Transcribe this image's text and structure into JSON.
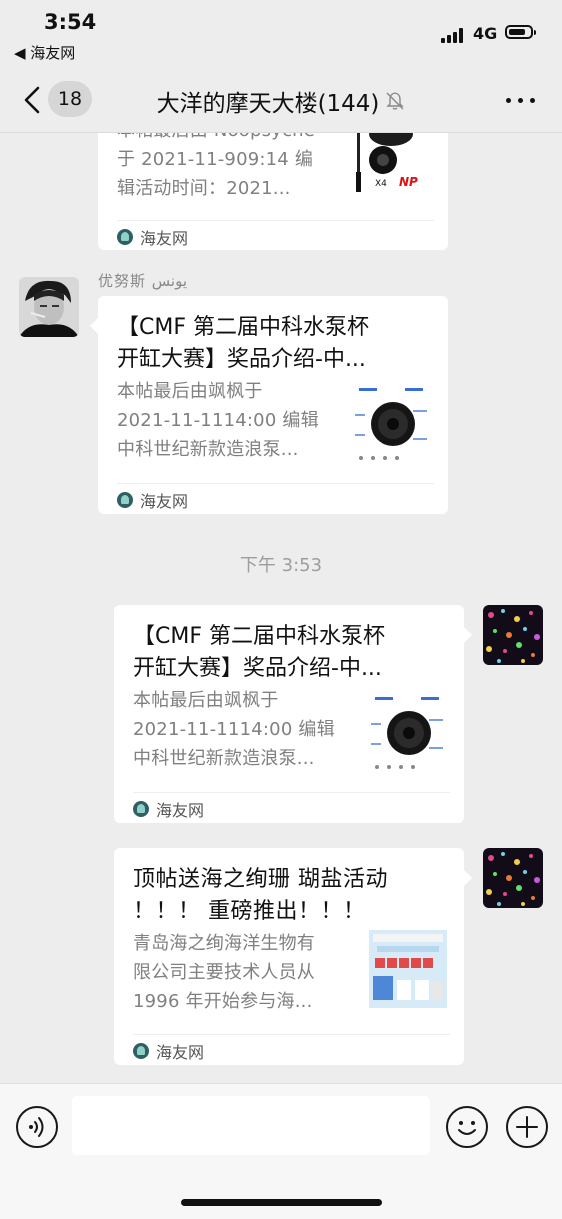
{
  "status": {
    "time": "3:54",
    "back_app": "◀ 海友网",
    "network": "4G",
    "battery_level": 0.8
  },
  "nav": {
    "unread_count": "18",
    "title": "大洋的摩天大楼(144)",
    "muted": true
  },
  "messages": [
    {
      "direction": "incoming",
      "desc_lines": [
        "本帖最后由 Noopsyche",
        "于 2021-11-909:14 编",
        "辑活动时间：2021..."
      ],
      "source": "海友网"
    },
    {
      "direction": "incoming",
      "sender": "优努斯 يونس",
      "title_lines": [
        "【CMF 第二届中科水泵杯",
        "开缸大赛】奖品介绍-中..."
      ],
      "desc_lines": [
        "本帖最后由飒枫于",
        "2021-11-1114:00 编辑",
        "中科世纪新款造浪泵..."
      ],
      "source": "海友网"
    },
    {
      "type": "timestamp",
      "text": "下午 3:53"
    },
    {
      "direction": "outgoing",
      "title_lines": [
        "【CMF 第二届中科水泵杯",
        "开缸大赛】奖品介绍-中..."
      ],
      "desc_lines": [
        "本帖最后由飒枫于",
        "2021-11-1114:00 编辑",
        "中科世纪新款造浪泵..."
      ],
      "source": "海友网"
    },
    {
      "direction": "outgoing",
      "title_lines": [
        "顶帖送海之绚珊 瑚盐活动",
        "！！！ 重磅推出！！！"
      ],
      "desc_lines": [
        "青岛海之绚海洋生物有",
        "限公司主要技术人员从",
        "1996 年开始参与海..."
      ],
      "source": "海友网"
    }
  ],
  "composer": {
    "value": "",
    "placeholder": ""
  }
}
